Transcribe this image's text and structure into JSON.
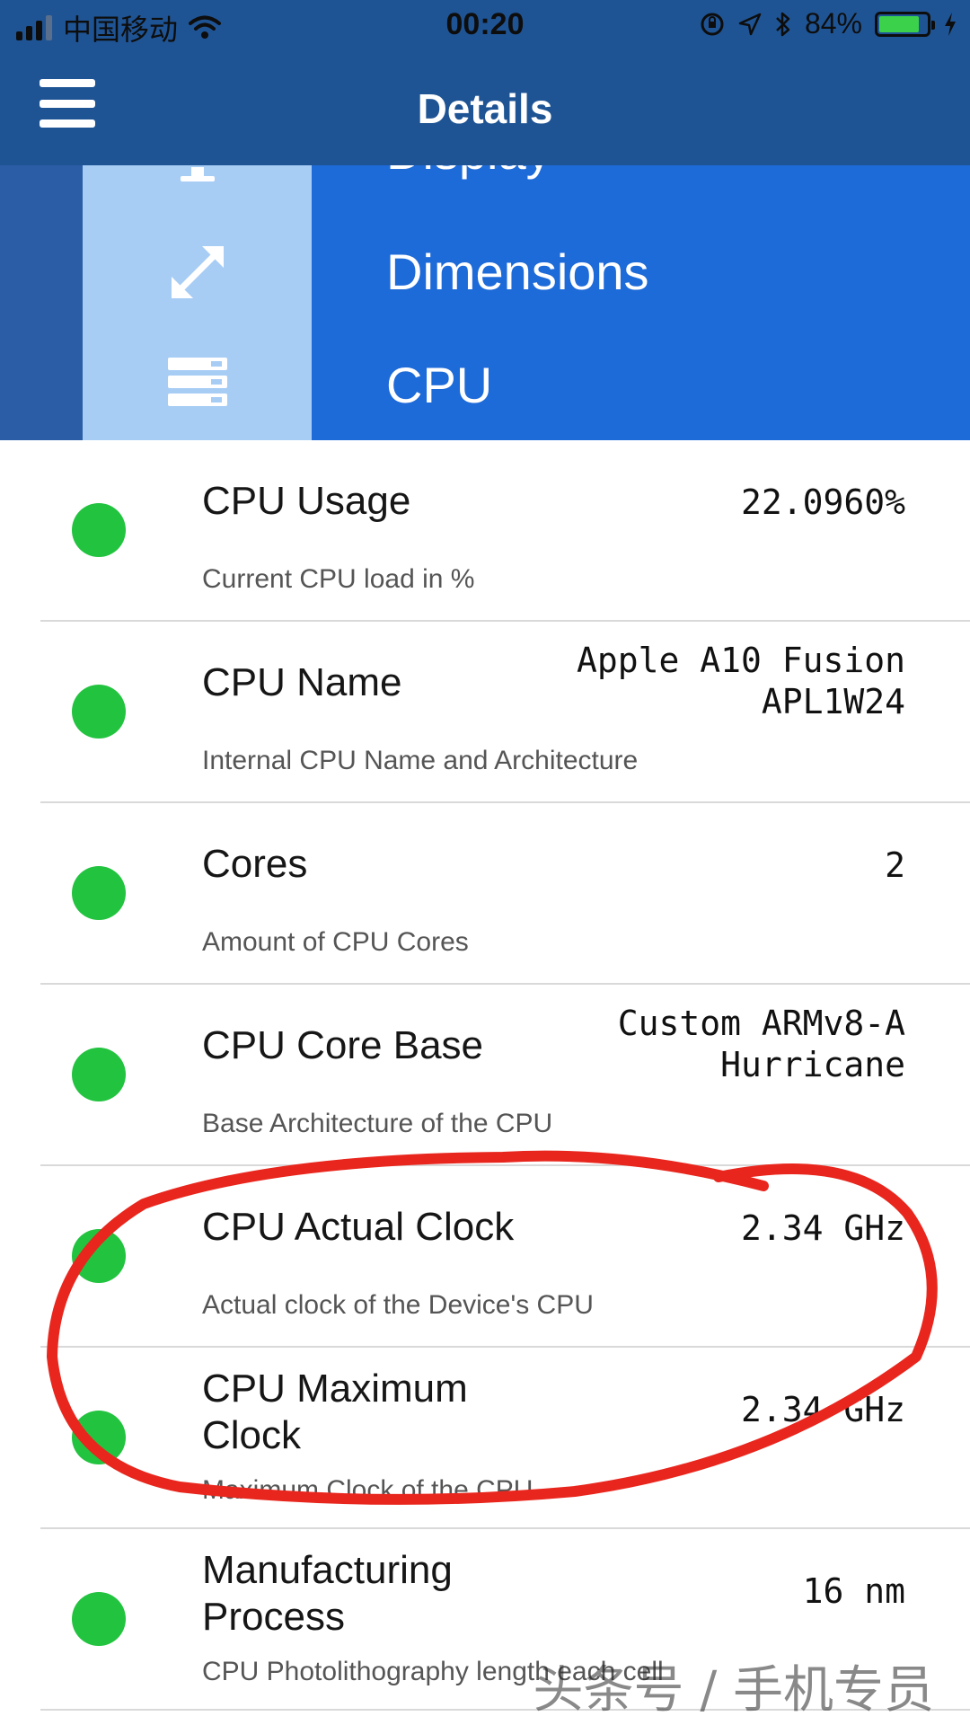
{
  "status_bar": {
    "carrier": "中国移动",
    "time": "00:20",
    "battery_percent_label": "84%",
    "battery_level": 0.84
  },
  "nav": {
    "title": "Details"
  },
  "categories": [
    {
      "label": "Display",
      "icon": "monitor-icon"
    },
    {
      "label": "Dimensions",
      "icon": "resize-arrows-icon"
    },
    {
      "label": "CPU",
      "icon": "server-icon"
    }
  ],
  "items": [
    {
      "title": "CPU Usage",
      "subtitle": "Current CPU load in %",
      "value": "22.0960%"
    },
    {
      "title": "CPU Name",
      "subtitle": "Internal CPU Name and Architecture",
      "value": "Apple A10 Fusion\nAPL1W24"
    },
    {
      "title": "Cores",
      "subtitle": "Amount of CPU Cores",
      "value": "2"
    },
    {
      "title": "CPU Core Base",
      "subtitle": "Base Architecture of the CPU",
      "value": "Custom ARMv8-A\nHurricane"
    },
    {
      "title": "CPU Actual Clock",
      "subtitle": "Actual clock of the Device's CPU",
      "value": "2.34 GHz"
    },
    {
      "title": "CPU Maximum Clock",
      "subtitle": "Maximum Clock of the CPU",
      "value": "2.34 GHz"
    },
    {
      "title": "Manufacturing Process",
      "subtitle": "CPU Photolithography length each cell",
      "value": "16 nm"
    }
  ],
  "colors": {
    "nav_bg": "#1f5494",
    "category_highlight": "#1d6ad9",
    "icon_column": "#a8cdf5",
    "status_dot": "#22c33f",
    "marker": "#e8261d"
  },
  "watermark": "头条号 / 手机专员"
}
